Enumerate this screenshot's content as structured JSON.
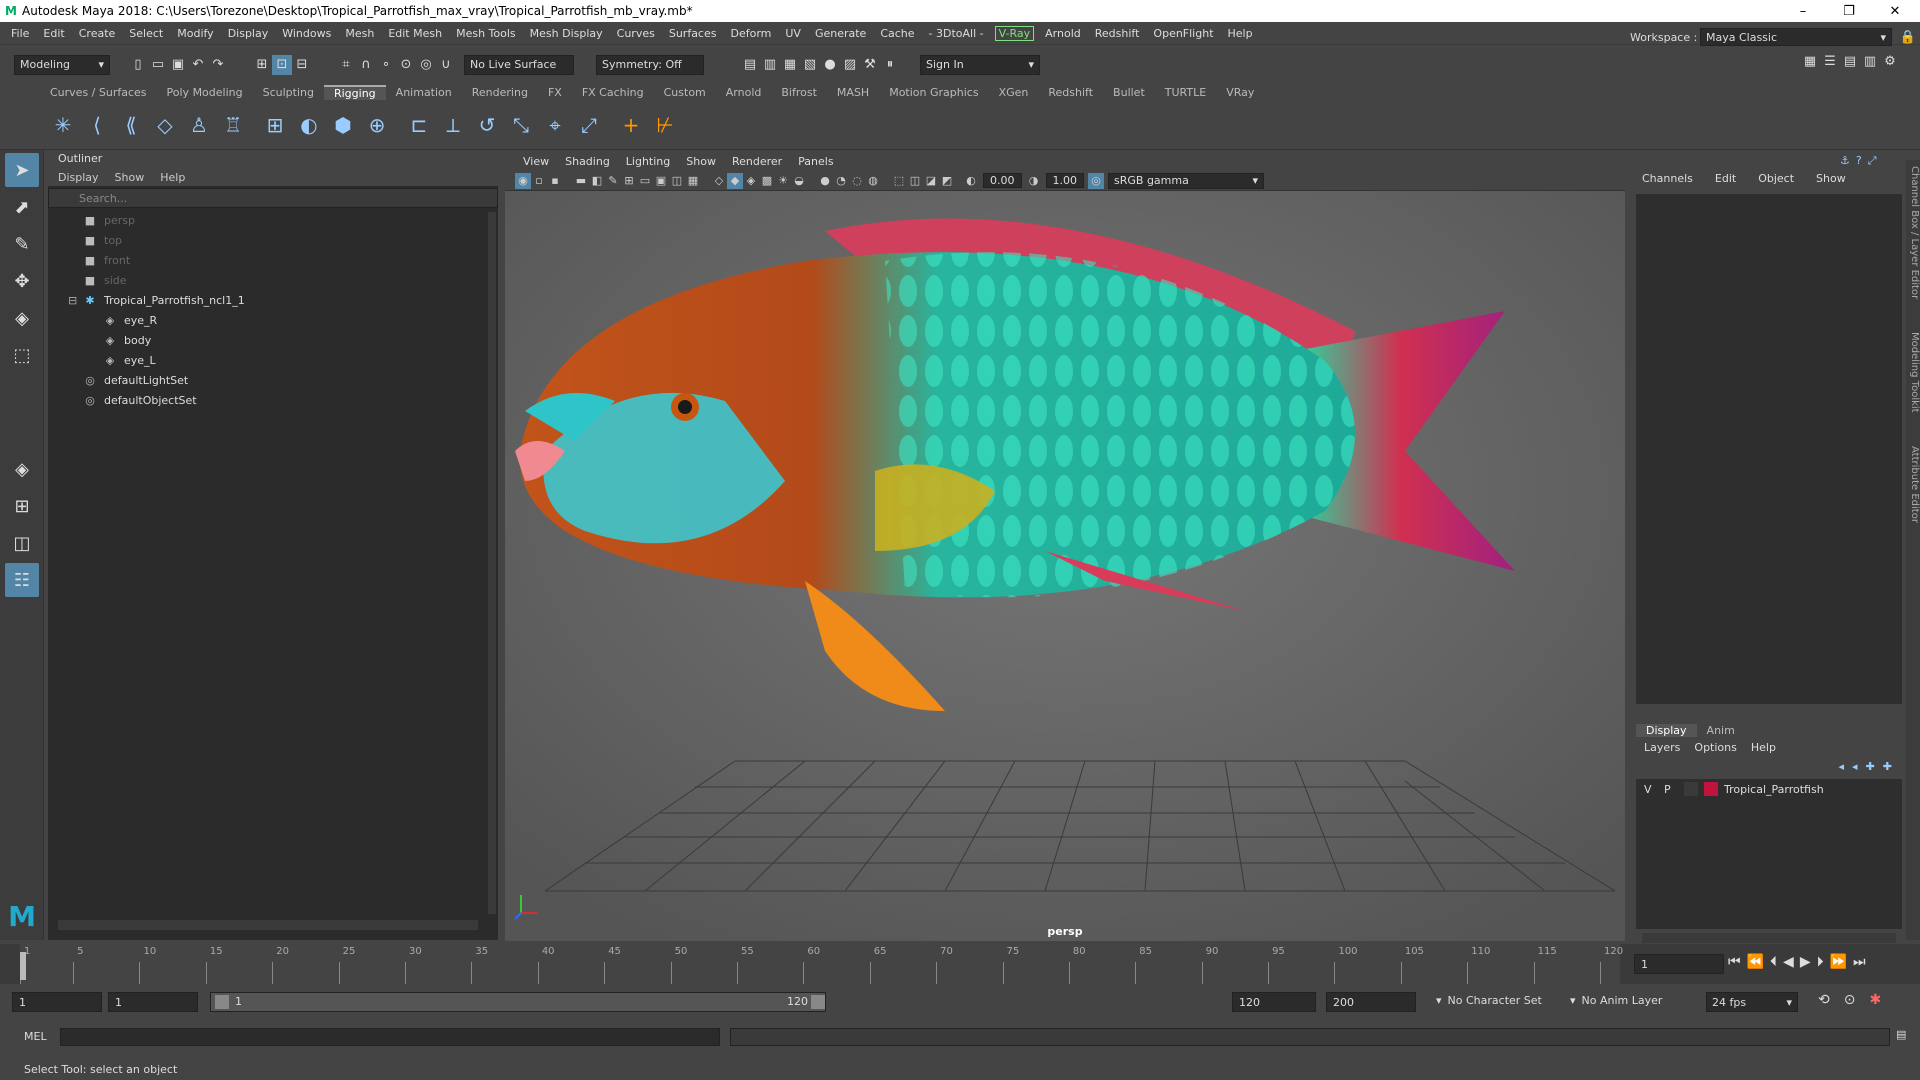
{
  "window": {
    "title": "Autodesk Maya 2018: C:\\Users\\Torezone\\Desktop\\Tropical_Parrotfish_max_vray\\Tropical_Parrotfish_mb_vray.mb*",
    "minimize": "–",
    "maximize": "❐",
    "close": "✕"
  },
  "menubar": {
    "items": [
      "File",
      "Edit",
      "Create",
      "Select",
      "Modify",
      "Display",
      "Windows",
      "Mesh",
      "Edit Mesh",
      "Mesh Tools",
      "Mesh Display",
      "Curves",
      "Surfaces",
      "Deform",
      "UV",
      "Generate",
      "Cache",
      "- 3DtoAll -"
    ],
    "vray": "V-Ray",
    "items2": [
      "Arnold",
      "Redshift",
      "OpenFlight",
      "Help"
    ],
    "workspace_label": "Workspace :",
    "workspace_value": "Maya Classic"
  },
  "statusline": {
    "mode": "Modeling",
    "live_surface": "No Live Surface",
    "symmetry": "Symmetry: Off",
    "sign_in": "Sign In"
  },
  "shelf": {
    "tabs": [
      "Curves / Surfaces",
      "Poly Modeling",
      "Sculpting",
      "Rigging",
      "Animation",
      "Rendering",
      "FX",
      "FX Caching",
      "Custom",
      "Arnold",
      "Bifrost",
      "MASH",
      "Motion Graphics",
      "XGen",
      "Redshift",
      "Bullet",
      "TURTLE",
      "VRay"
    ],
    "active_tab": "Rigging"
  },
  "outliner": {
    "title": "Outliner",
    "menu": [
      "Display",
      "Show",
      "Help"
    ],
    "search_placeholder": "Search...",
    "items": [
      {
        "label": "persp",
        "icon": "camera-icon",
        "indent": 0,
        "dim": true
      },
      {
        "label": "top",
        "icon": "camera-icon",
        "indent": 0,
        "dim": true
      },
      {
        "label": "front",
        "icon": "camera-icon",
        "indent": 0,
        "dim": true
      },
      {
        "label": "side",
        "icon": "camera-icon",
        "indent": 0,
        "dim": true
      },
      {
        "label": "Tropical_Parrotfish_ncl1_1",
        "icon": "joint-icon",
        "indent": 0,
        "dim": false,
        "expanded": true
      },
      {
        "label": "eye_R",
        "icon": "mesh-icon",
        "indent": 1,
        "dim": false
      },
      {
        "label": "body",
        "icon": "mesh-icon",
        "indent": 1,
        "dim": false
      },
      {
        "label": "eye_L",
        "icon": "mesh-icon",
        "indent": 1,
        "dim": false
      },
      {
        "label": "defaultLightSet",
        "icon": "set-icon",
        "indent": 0,
        "dim": false
      },
      {
        "label": "defaultObjectSet",
        "icon": "set-icon",
        "indent": 0,
        "dim": false
      }
    ]
  },
  "viewport": {
    "menu": [
      "View",
      "Shading",
      "Lighting",
      "Show",
      "Renderer",
      "Panels"
    ],
    "exposure": "0.00",
    "gamma": "1.00",
    "color_space": "sRGB gamma",
    "camera_label": "persp"
  },
  "channelbox": {
    "menu": [
      "Channels",
      "Edit",
      "Object",
      "Show"
    ],
    "side_tabs": [
      "Channel Box / Layer Editor",
      "Modeling Toolkit",
      "Attribute Editor"
    ],
    "layer_tabs": [
      "Display",
      "Anim"
    ],
    "layer_menu": [
      "Layers",
      "Options",
      "Help"
    ],
    "layer": {
      "v": "V",
      "p": "P",
      "name": "Tropical_Parrotfish",
      "color": "#c0143c"
    }
  },
  "timeline": {
    "ticks": [
      "1",
      "5",
      "10",
      "15",
      "20",
      "25",
      "30",
      "35",
      "40",
      "45",
      "50",
      "55",
      "60",
      "65",
      "70",
      "75",
      "80",
      "85",
      "90",
      "95",
      "100",
      "105",
      "110",
      "115",
      "120"
    ],
    "current_frame": "1"
  },
  "range": {
    "start": "1",
    "playback_start": "1",
    "slider_start": "1",
    "slider_end": "120",
    "playback_end": "120",
    "end": "200",
    "character_set": "No Character Set",
    "anim_layer": "No Anim Layer",
    "fps": "24 fps"
  },
  "mel": {
    "label": "MEL"
  },
  "status": {
    "help": "Select Tool: select an object"
  }
}
